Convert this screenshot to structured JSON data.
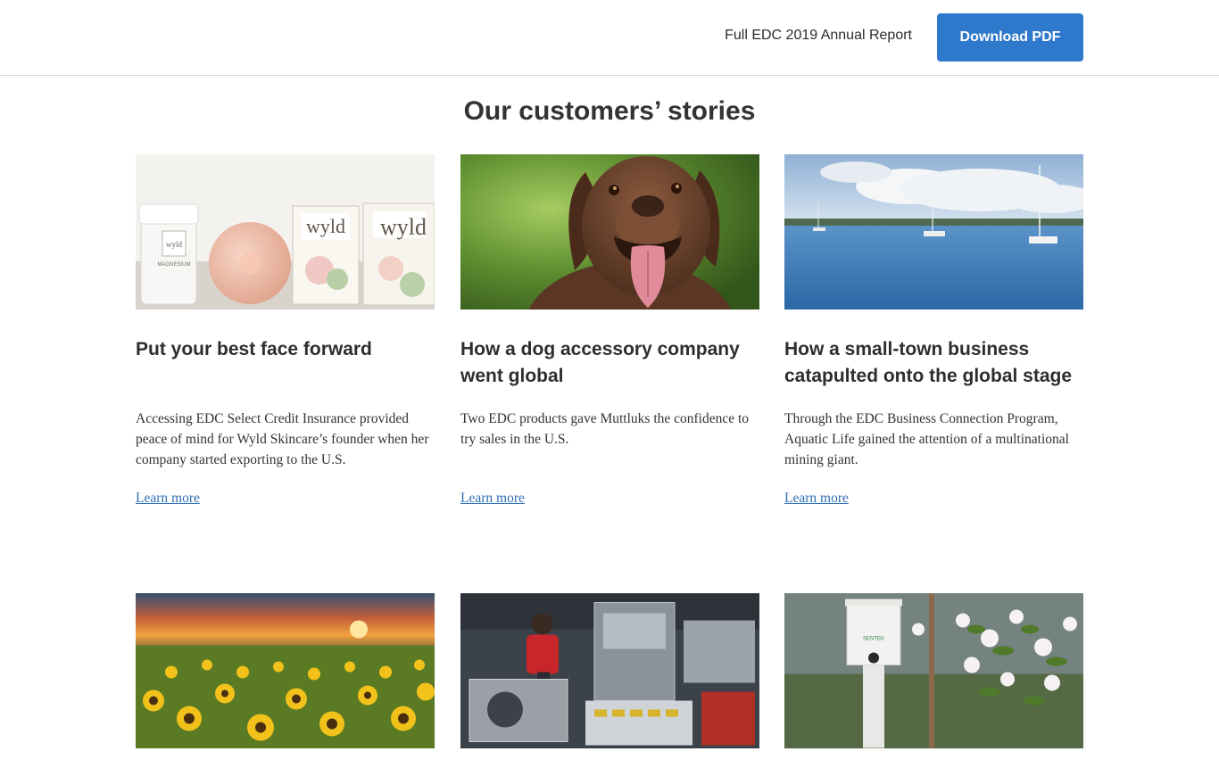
{
  "header": {
    "report_label": "Full EDC 2019 Annual Report",
    "download_label": "Download PDF"
  },
  "section": {
    "title": "Our customers’ stories"
  },
  "cards": [
    {
      "title": "Put your best face forward",
      "description": "Accessing EDC Select Credit Insurance provided peace of mind for Wyld Skincare’s founder when her company started exporting to the U.S.",
      "link": "Learn more",
      "image_labels": [
        "wyld",
        "wyld",
        "wyld",
        "MAGNESIUM"
      ]
    },
    {
      "title": "How a dog accessory company went global",
      "description": "Two EDC products gave Muttluks the confidence to try sales in the U.S.",
      "link": "Learn more"
    },
    {
      "title": "How a small-town business catapulted onto the global stage",
      "description": "Through the EDC Business Connection Program, Aquatic Life gained the attention of a multinational mining giant.",
      "link": "Learn more"
    },
    {},
    {},
    {
      "image_labels": [
        "SENTEK"
      ]
    }
  ],
  "colors": {
    "accent": "#2f79cc",
    "link": "#2f6fb7",
    "divider": "#d9d9d9"
  }
}
